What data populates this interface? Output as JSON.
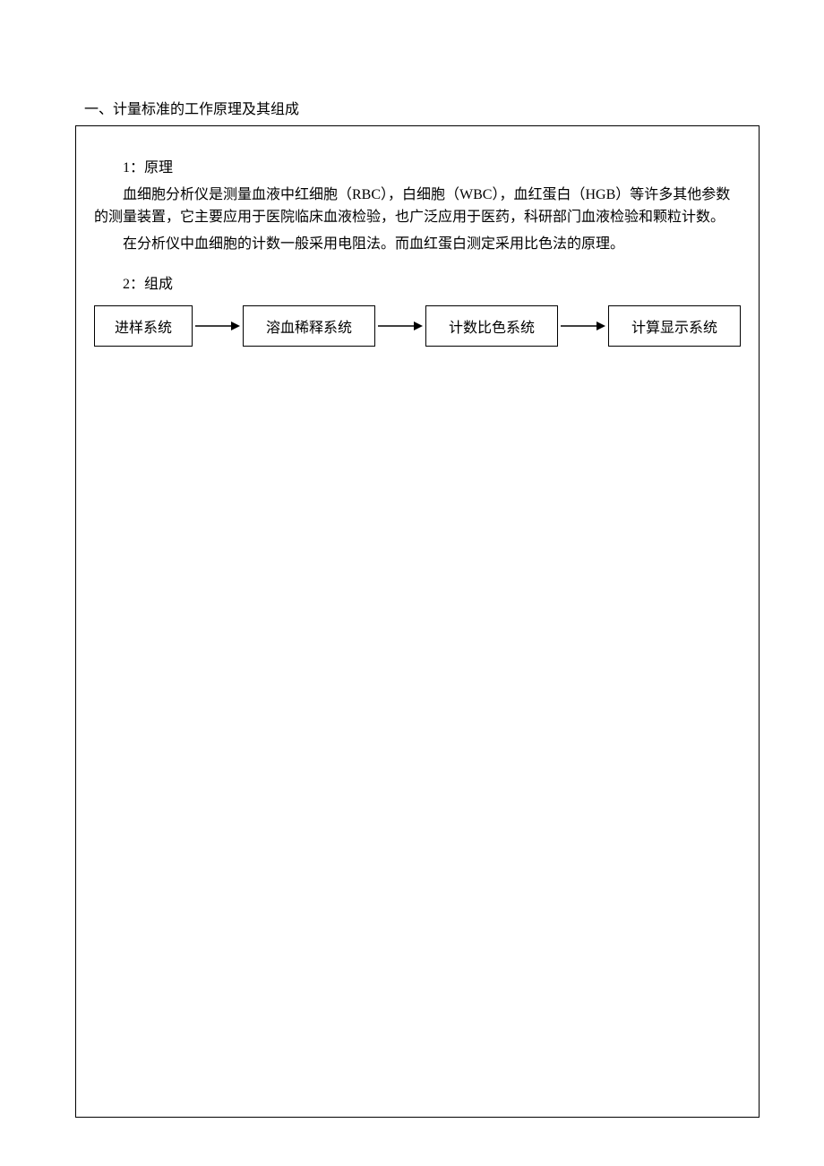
{
  "title": "一、计量标准的工作原理及其组成",
  "section1": {
    "heading": "1：原理",
    "p1": "血细胞分析仪是测量血液中红细胞（RBC），白细胞（WBC），血红蛋白（HGB）等许多其他参数的测量装置，它主要应用于医院临床血液检验，也广泛应用于医药，科研部门血液检验和颗粒计数。",
    "p2": "在分析仪中血细胞的计数一般采用电阻法。而血红蛋白测定采用比色法的原理。"
  },
  "section2": {
    "heading": "2：组成"
  },
  "flow": {
    "boxes": [
      "进样系统",
      "溶血稀释系统",
      "计数比色系统",
      "计算显示系统"
    ]
  }
}
